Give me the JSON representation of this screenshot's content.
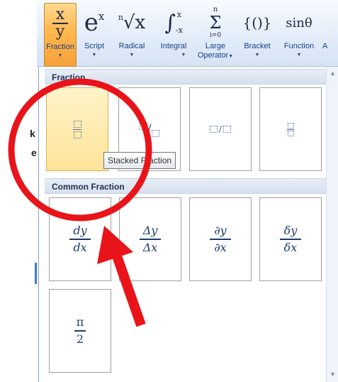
{
  "ribbon": {
    "buttons": [
      {
        "label": "Fraction",
        "glyph_top": "x",
        "glyph_bottom": "y",
        "active": true
      },
      {
        "label": "Script",
        "glyph": "e",
        "sup": "x"
      },
      {
        "label": "Radical",
        "glyph": "√x",
        "sup": "n"
      },
      {
        "label": "Integral",
        "glyph": "∫",
        "sup": "x",
        "sub": "-x"
      },
      {
        "label": "Large",
        "label2": "Operator",
        "glyph": "Σ",
        "sup": "n",
        "sub": "i=0"
      },
      {
        "label": "Bracket",
        "glyph": "{()}"
      },
      {
        "label": "Function",
        "glyph": "sinθ"
      },
      {
        "label": "A"
      }
    ]
  },
  "gallery": {
    "section_fraction": "Fraction",
    "section_common": "Common Fraction",
    "tooltip": "Stacked Fraction",
    "common_fractions": [
      {
        "num": "dy",
        "den": "dx"
      },
      {
        "num": "Δy",
        "den": "Δx"
      },
      {
        "num": "∂y",
        "den": "∂x"
      },
      {
        "num": "δy",
        "den": "δx"
      },
      {
        "num": "π",
        "den": "2"
      }
    ]
  },
  "left_page": {
    "frag1": "k",
    "frag2": "e"
  },
  "colors": {
    "annotation_red": "#e8141a",
    "accent_orange": "#ffb74d",
    "ribbon_text": "#15428b"
  }
}
